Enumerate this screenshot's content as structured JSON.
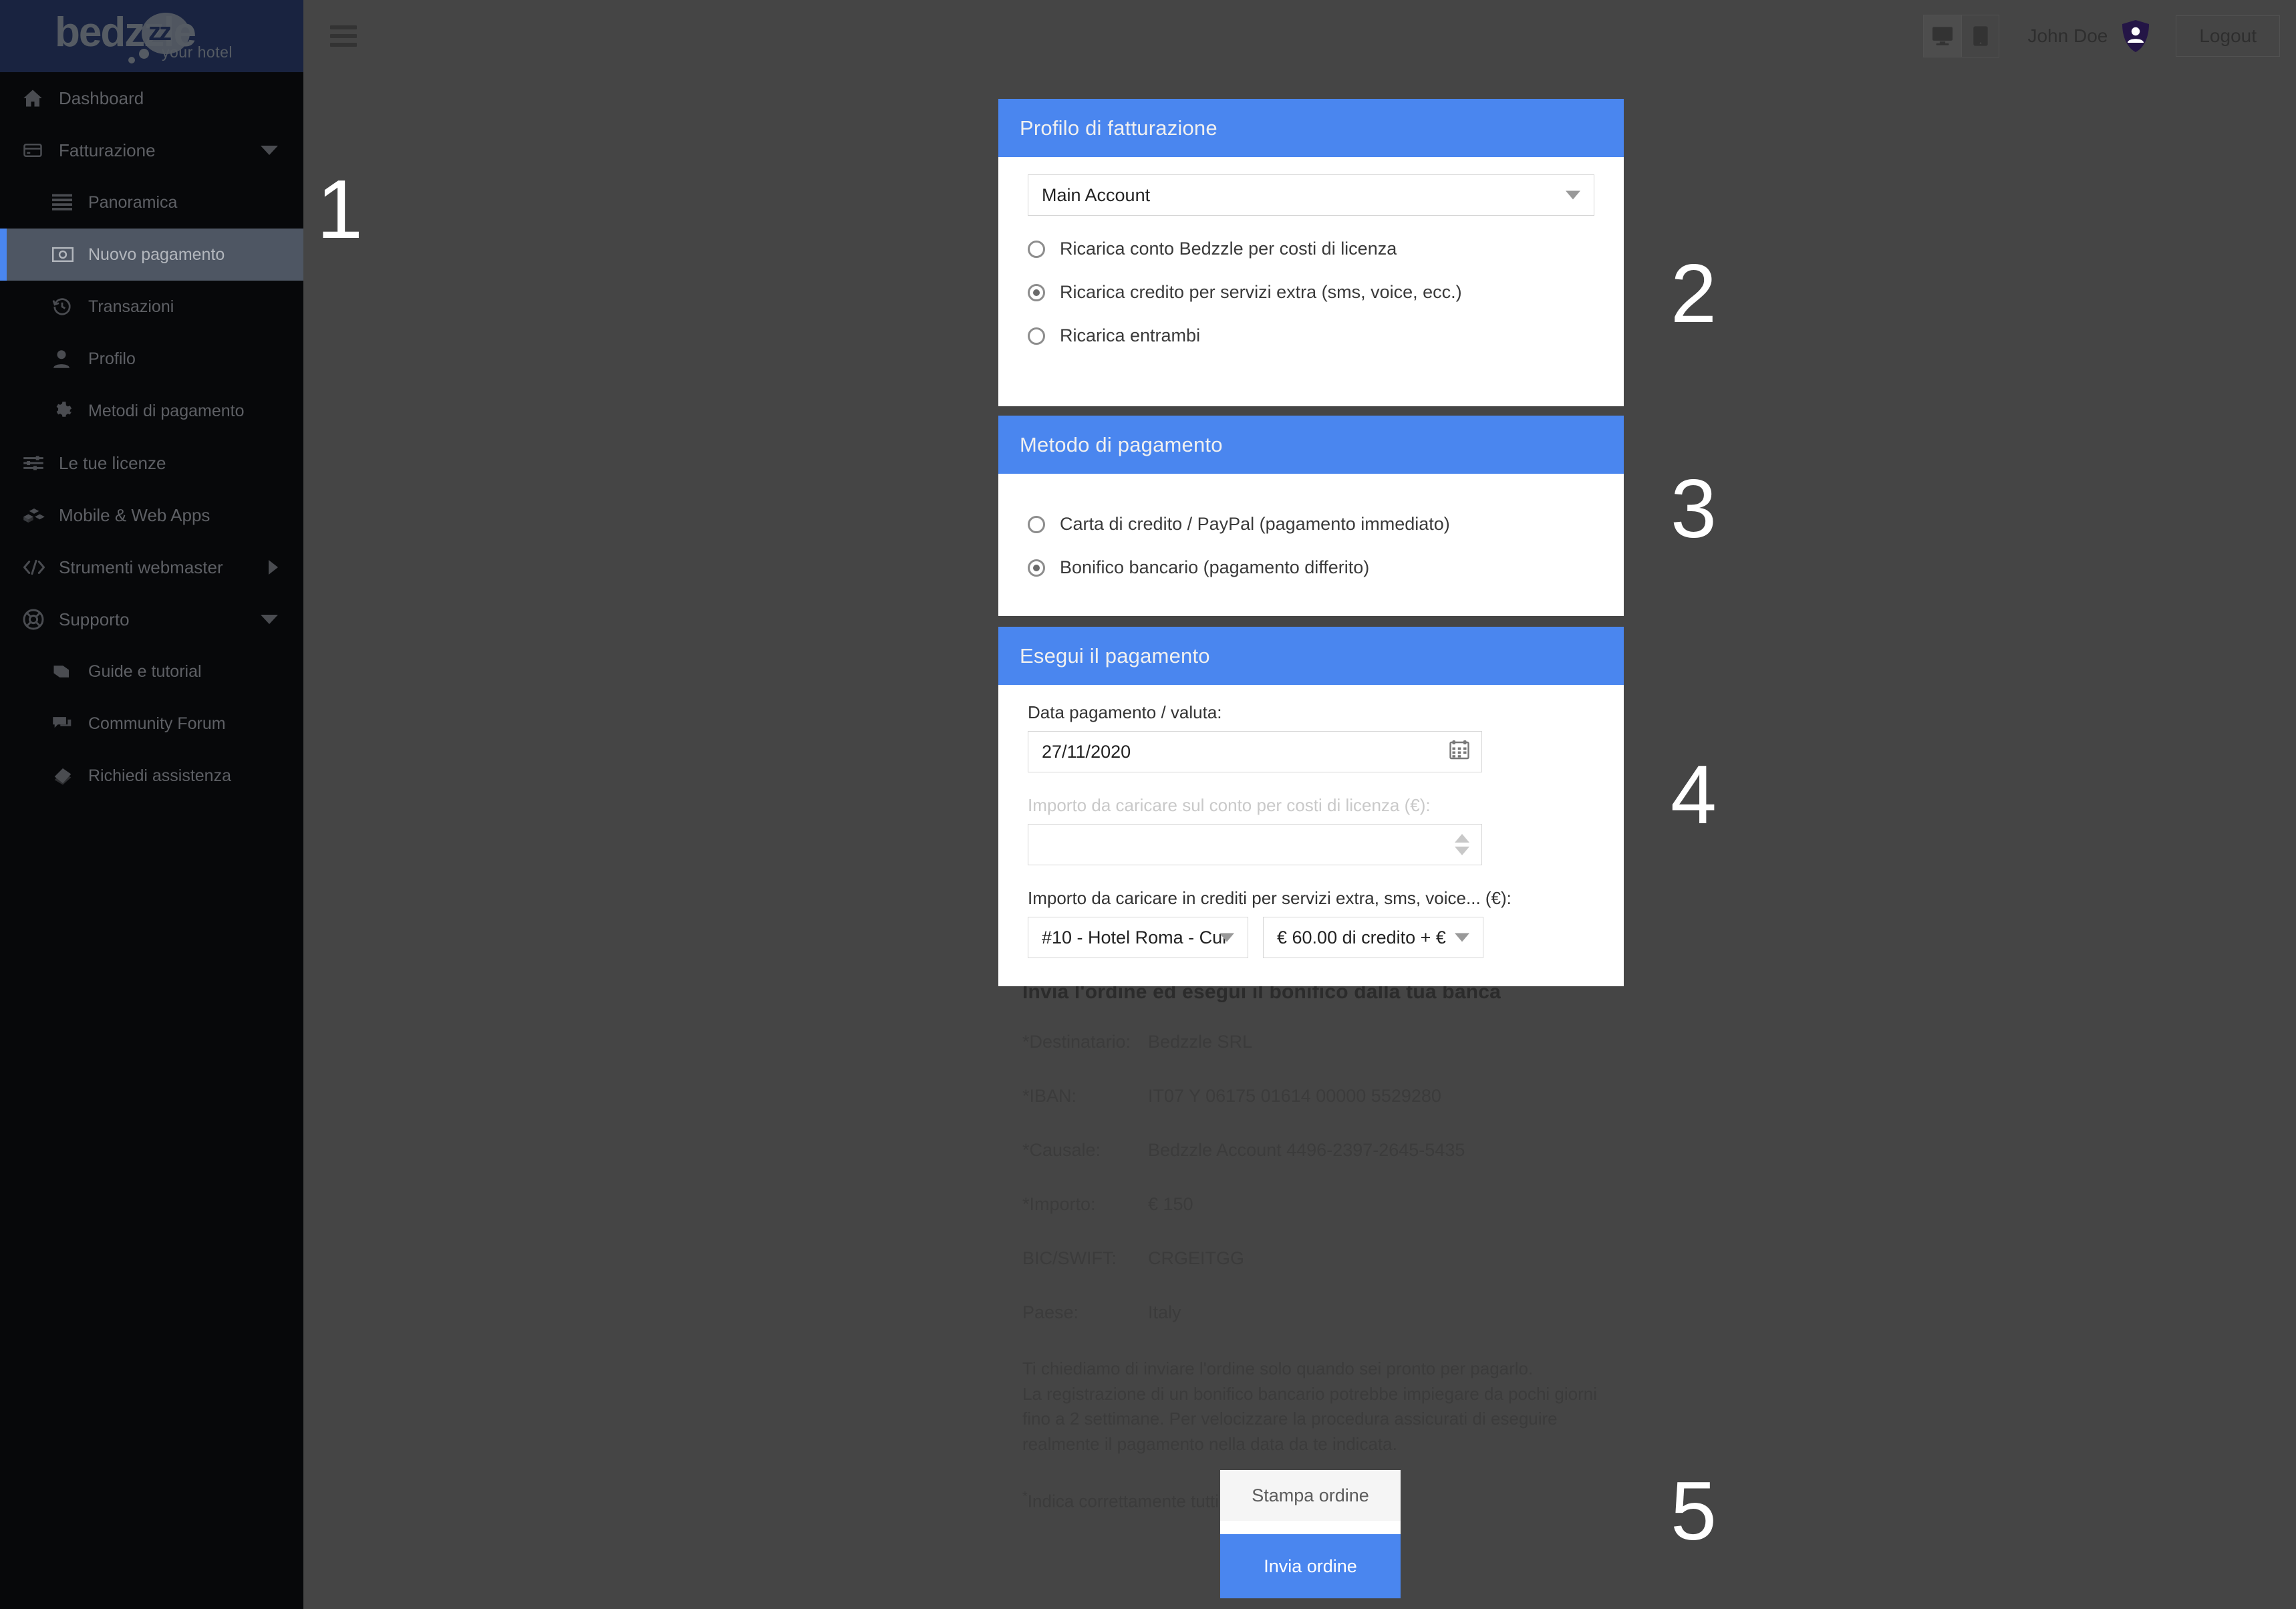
{
  "brand": {
    "logo_text": "bedzzle",
    "logo_z": "zz",
    "tagline": "your hotel",
    "navy": "#192340",
    "accent": "#4a86ef"
  },
  "sidebar": {
    "items": [
      {
        "label": "Dashboard",
        "icon": "home-icon",
        "level": "top",
        "caret": "none",
        "active": false
      },
      {
        "label": "Fatturazione",
        "icon": "credit-card-icon",
        "level": "top",
        "caret": "down",
        "active": false
      },
      {
        "label": "Panoramica",
        "icon": "list-icon",
        "level": "sub",
        "caret": "none",
        "active": false
      },
      {
        "label": "Nuovo pagamento",
        "icon": "banknote-icon",
        "level": "sub",
        "caret": "none",
        "active": true
      },
      {
        "label": "Transazioni",
        "icon": "history-icon",
        "level": "sub",
        "caret": "none",
        "active": false
      },
      {
        "label": "Profilo",
        "icon": "user-icon",
        "level": "sub",
        "caret": "none",
        "active": false
      },
      {
        "label": "Metodi di pagamento",
        "icon": "gear-icon",
        "level": "sub",
        "caret": "none",
        "active": false
      },
      {
        "label": "Le tue licenze",
        "icon": "sliders-icon",
        "level": "top",
        "caret": "none",
        "active": false
      },
      {
        "label": "Mobile & Web Apps",
        "icon": "boxes-icon",
        "level": "top",
        "caret": "none",
        "active": false
      },
      {
        "label": "Strumenti webmaster",
        "icon": "code-icon",
        "level": "top",
        "caret": "right",
        "active": false
      },
      {
        "label": "Supporto",
        "icon": "lifering-icon",
        "level": "top",
        "caret": "down",
        "active": false
      },
      {
        "label": "Guide e tutorial",
        "icon": "book-icon",
        "level": "sub",
        "caret": "none",
        "active": false
      },
      {
        "label": "Community Forum",
        "icon": "comments-icon",
        "level": "sub",
        "caret": "none",
        "active": false
      },
      {
        "label": "Richiedi assistenza",
        "icon": "ticket-icon",
        "level": "sub",
        "caret": "none",
        "active": false
      }
    ]
  },
  "topbar": {
    "menu_toggle": "hamburger-icon",
    "desktop_view": "desktop-icon",
    "mobile_view": "tablet-icon",
    "user_name": "John Doe",
    "avatar": "shield-user-icon",
    "logout_label": "Logout"
  },
  "billing_profile": {
    "title": "Profilo di fatturazione",
    "account_select": "Main Account",
    "options": [
      {
        "label": "Ricarica conto Bedzzle per costi di licenza",
        "checked": false
      },
      {
        "label": "Ricarica credito per servizi extra (sms, voice, ecc.)",
        "checked": true
      },
      {
        "label": "Ricarica entrambi",
        "checked": false
      }
    ]
  },
  "payment_method": {
    "title": "Metodo di pagamento",
    "options": [
      {
        "label": "Carta di credito / PayPal (pagamento immediato)",
        "checked": false
      },
      {
        "label": "Bonifico bancario (pagamento differito)",
        "checked": true
      }
    ]
  },
  "execute_payment": {
    "title": "Esegui il pagamento",
    "date_label": "Data pagamento / valuta:",
    "date_value": "27/11/2020",
    "license_amount_label": "Importo da caricare sul conto per costi di licenza (€):",
    "license_amount_value": "",
    "credit_amount_label": "Importo da caricare in crediti per servizi extra, sms, voice... (€):",
    "credit_hotel_select": "#10 - Hotel Roma - Cur",
    "credit_package_select": "€ 60.00 di credito + €"
  },
  "bank_transfer": {
    "heading": "Invia l'ordine ed esegui il bonifico dalla tua banca",
    "rows": [
      {
        "key": "*Destinatario:",
        "value": "Bedzzle SRL"
      },
      {
        "key": "*IBAN:",
        "value": "IT07 Y 06175 01614 00000 5529280"
      },
      {
        "key": "*Causale:",
        "value": "Bedzzle Account 4496-2397-2645-5435"
      },
      {
        "key": "*Importo:",
        "value": "€ 150"
      },
      {
        "key": "BIC/SWIFT:",
        "value": "CRGEITGG"
      },
      {
        "key": "Paese:",
        "value": "Italy"
      }
    ],
    "note": "Ti chiediamo di inviare l'ordine solo quando sei pronto per pagarlo.\nLa registrazione di un bonifico bancario potrebbe impiegare da pochi giorni\nfino a 2 settimane. Per velocizzare la procedura assicurati di eseguire\nrealmente il pagamento nella data da te indicata.",
    "footnote": "Indica correttamente tutti i valori nel tuo bonifico",
    "footnote_marker": "*"
  },
  "actions": {
    "print_label": "Stampa ordine",
    "send_label": "Invia ordine"
  },
  "steps": {
    "one": "1",
    "two": "2",
    "three": "3",
    "four": "4",
    "five": "5"
  }
}
